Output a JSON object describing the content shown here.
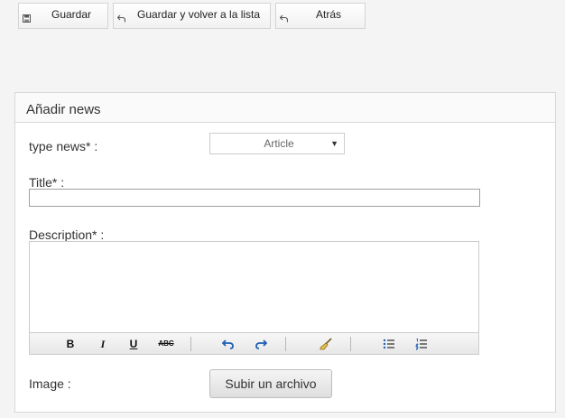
{
  "toolbar": {
    "save_label": "Guardar",
    "save_list_label": "Guardar y volver a la lista",
    "back_label": "Atrás"
  },
  "panel": {
    "title": "Añadir news"
  },
  "form": {
    "type_label": "type news* :",
    "type_value": "Article",
    "title_label": "Title* :",
    "title_value": "",
    "description_label": "Description* :",
    "image_label": "Image :",
    "upload_label": "Subir un archivo"
  },
  "editor_toolbar": {
    "bold": "B",
    "italic": "I",
    "underline": "U",
    "strike": "ABC"
  }
}
